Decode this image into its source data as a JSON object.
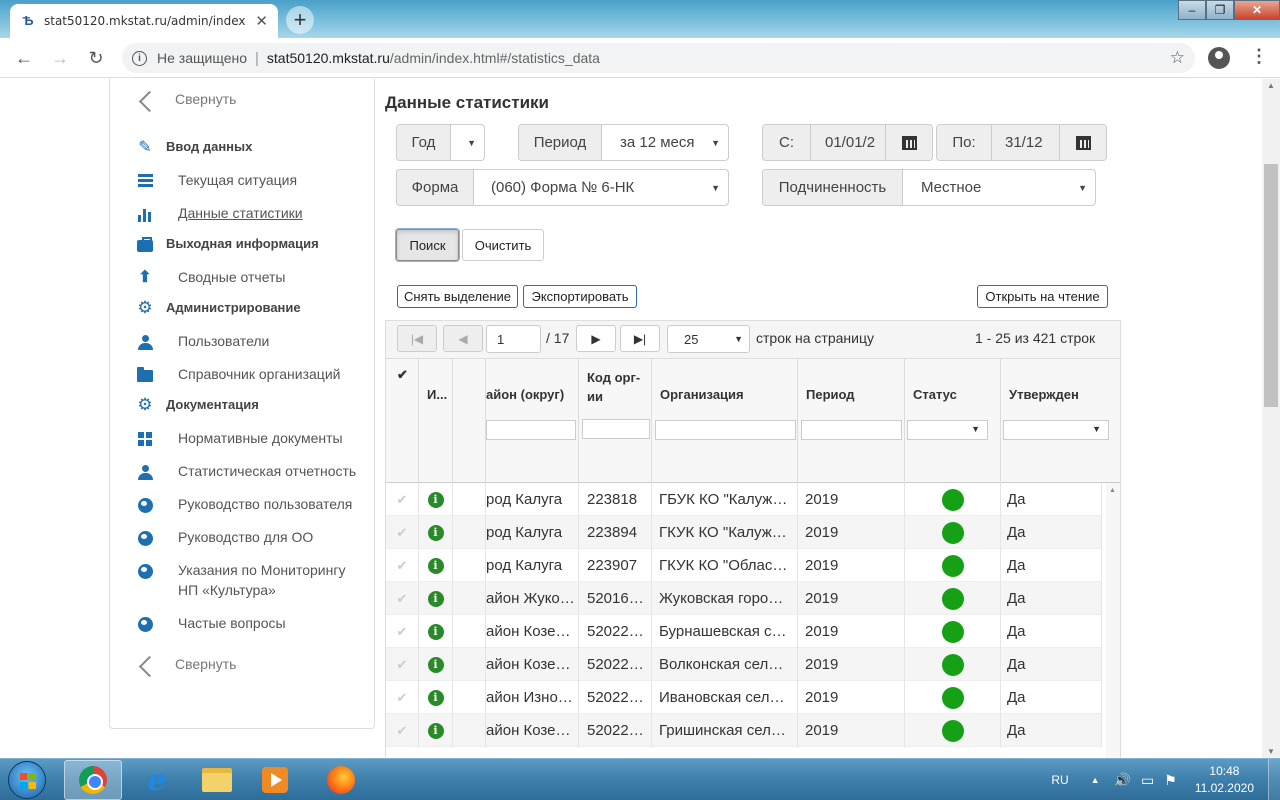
{
  "browser": {
    "tab_title": "stat50120.mkstat.ru/admin/index",
    "tab_favicon": "msk-logo-icon",
    "security_label": "Не защищено",
    "url_host": "stat50120.mkstat.ru",
    "url_path": "/admin/index.html#/statistics_data"
  },
  "sidebar": {
    "collapse_top": "Свернуть",
    "collapse_bottom": "Свернуть",
    "items": [
      {
        "label": "Ввод данных",
        "type": "group",
        "icon": "edit-icon"
      },
      {
        "label": "Текущая ситуация",
        "type": "link",
        "icon": "list-icon"
      },
      {
        "label": "Данные статистики",
        "type": "link",
        "icon": "bar-chart-icon",
        "active": true
      },
      {
        "label": "Выходная информация",
        "type": "group",
        "icon": "briefcase-icon"
      },
      {
        "label": "Сводные отчеты",
        "type": "link",
        "icon": "upload-icon"
      },
      {
        "label": "Администрирование",
        "type": "group",
        "icon": "gear-icon"
      },
      {
        "label": "Пользователи",
        "type": "link",
        "icon": "user-icon"
      },
      {
        "label": "Справочник организаций",
        "type": "link",
        "icon": "folder-icon"
      },
      {
        "label": "Документация",
        "type": "group",
        "icon": "gear-icon"
      },
      {
        "label": "Нормативные документы",
        "type": "link",
        "icon": "grid-icon"
      },
      {
        "label": "Статистическая отчетность",
        "type": "link",
        "icon": "user-icon"
      },
      {
        "label": "Руководство пользователя",
        "type": "link",
        "icon": "globe-icon"
      },
      {
        "label": "Руководство для ОО",
        "type": "link",
        "icon": "globe-icon"
      },
      {
        "label": "Указания по Мониторингу",
        "label2": "НП «Культура»",
        "type": "link",
        "icon": "globe-icon"
      },
      {
        "label": "Частые вопросы",
        "type": "link",
        "icon": "globe-icon"
      }
    ]
  },
  "page": {
    "title": "Данные статистики"
  },
  "filters": {
    "year_label": "Год",
    "year_value": "",
    "period_label": "Период",
    "period_value": "за 12 меся",
    "from_label": "С:",
    "from_value": "01/01/2",
    "to_label": "По:",
    "to_value": "31/12",
    "form_label": "Форма",
    "form_value": "(060) Форма № 6-НК",
    "subordination_label": "Подчиненность",
    "subordination_value": "Местное"
  },
  "actions": {
    "search": "Поиск",
    "clear": "Очистить",
    "deselect": "Снять выделение",
    "export": "Экспортировать",
    "open_readonly": "Открыть на чтение"
  },
  "pager": {
    "page": "1",
    "total_pages": "/ 17",
    "page_size": "25",
    "page_size_label": "строк на страницу",
    "summary": "1 - 25 из 421 строк"
  },
  "table": {
    "columns": {
      "info": "И...",
      "district": "айон (округ)",
      "org_code": "Код орг-ии",
      "organization": "Организация",
      "period": "Период",
      "status": "Статус",
      "approved": "Утвержден"
    },
    "status_color": "#16a016",
    "rows": [
      {
        "district": "род Калуга",
        "code": "223818",
        "org": "ГБУК КО \"Калуж…",
        "period": "2019",
        "approved": "Да"
      },
      {
        "district": "род Калуга",
        "code": "223894",
        "org": "ГКУК КО \"Калуж…",
        "period": "2019",
        "approved": "Да"
      },
      {
        "district": "род Калуга",
        "code": "223907",
        "org": "ГКУК КО \"Облас…",
        "period": "2019",
        "approved": "Да"
      },
      {
        "district": "айон Жуко…",
        "code": "52016…",
        "org": "Жуковская горо…",
        "period": "2019",
        "approved": "Да"
      },
      {
        "district": "айон Козе…",
        "code": "52022…",
        "org": "Бурнашевская с…",
        "period": "2019",
        "approved": "Да"
      },
      {
        "district": "айон Козе…",
        "code": "52022…",
        "org": "Волконская сел…",
        "period": "2019",
        "approved": "Да"
      },
      {
        "district": "айон Изно…",
        "code": "52022…",
        "org": "Ивановская сел…",
        "period": "2019",
        "approved": "Да"
      },
      {
        "district": "айон Козе…",
        "code": "52022…",
        "org": "Гришинская сел…",
        "period": "2019",
        "approved": "Да"
      }
    ]
  },
  "taskbar": {
    "lang": "RU",
    "time": "10:48",
    "date": "11.02.2020"
  }
}
